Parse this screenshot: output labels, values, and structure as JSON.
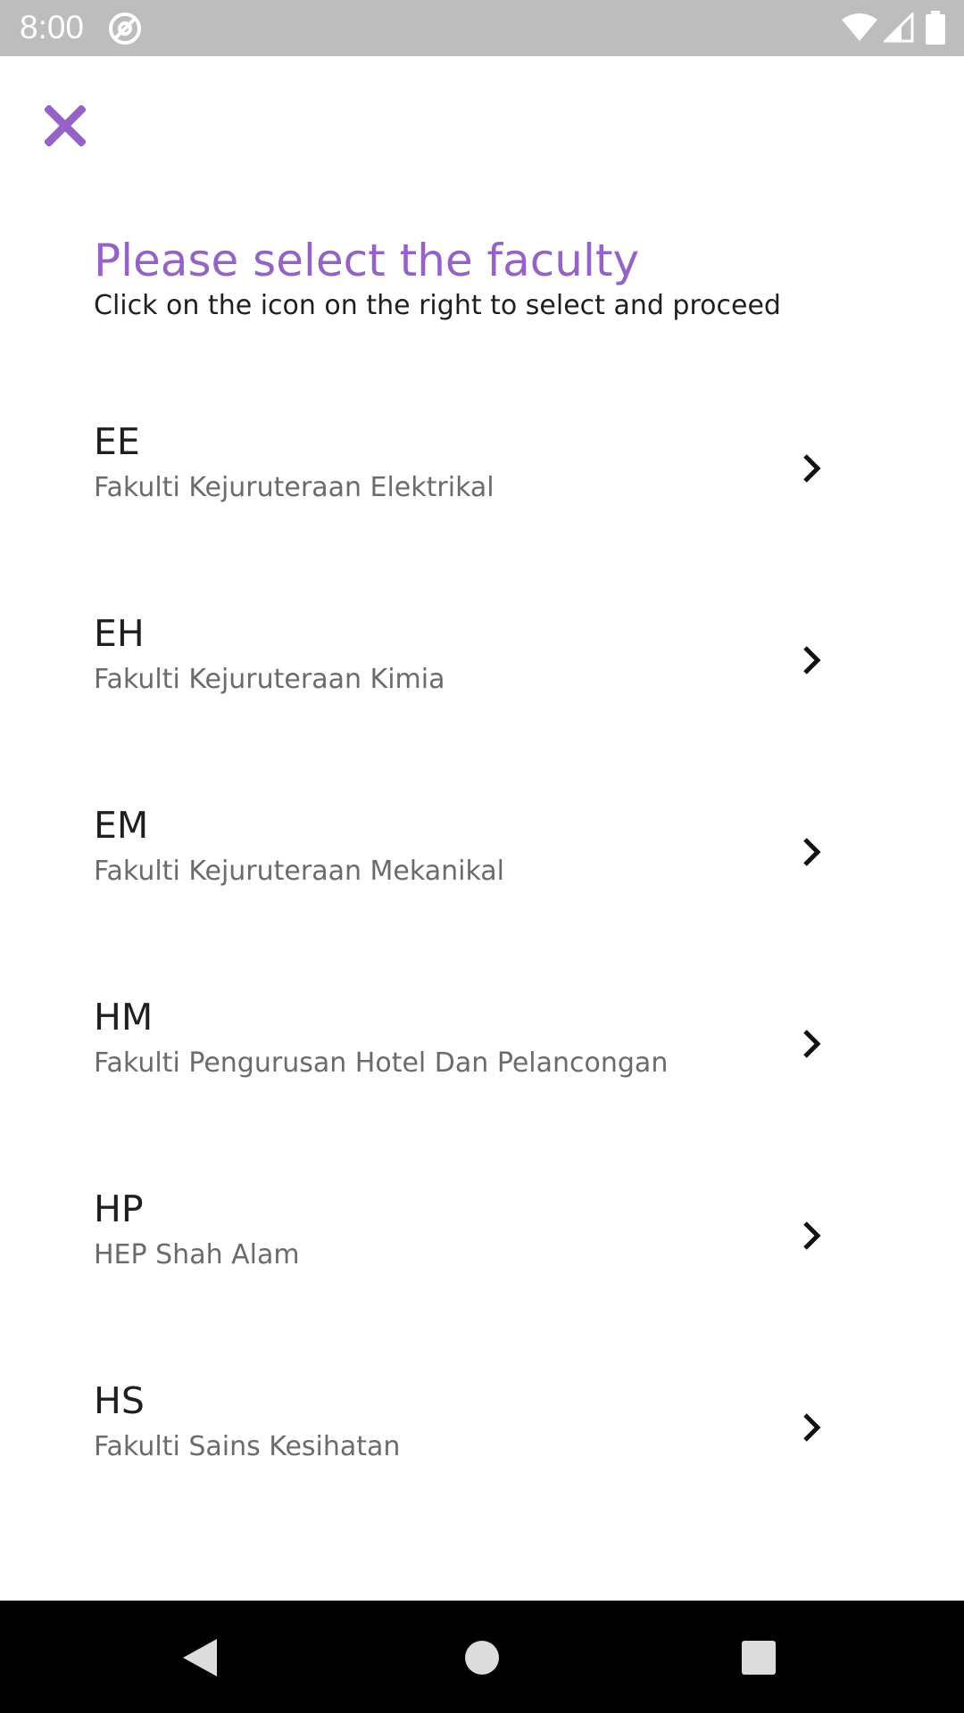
{
  "status_bar": {
    "time": "8:00",
    "icons": [
      "at-sign-icon",
      "wifi-icon",
      "cellular-signal-icon",
      "battery-icon"
    ]
  },
  "header": {
    "close_icon": "close-icon",
    "accent_color": "#9562c5"
  },
  "title": "Please select the faculty",
  "subtitle": "Click on the icon on the right to select and proceed",
  "faculties": [
    {
      "code": "EE",
      "name": "Fakulti Kejuruteraan Elektrikal"
    },
    {
      "code": "EH",
      "name": "Fakulti Kejuruteraan Kimia"
    },
    {
      "code": "EM",
      "name": "Fakulti Kejuruteraan Mekanikal"
    },
    {
      "code": "HM",
      "name": "Fakulti Pengurusan Hotel Dan Pelancongan"
    },
    {
      "code": "HP",
      "name": "HEP Shah Alam"
    },
    {
      "code": "HS",
      "name": "Fakulti Sains Kesihatan"
    }
  ],
  "nav_bar": {
    "icons": [
      "back-icon",
      "home-icon",
      "recents-icon"
    ]
  }
}
